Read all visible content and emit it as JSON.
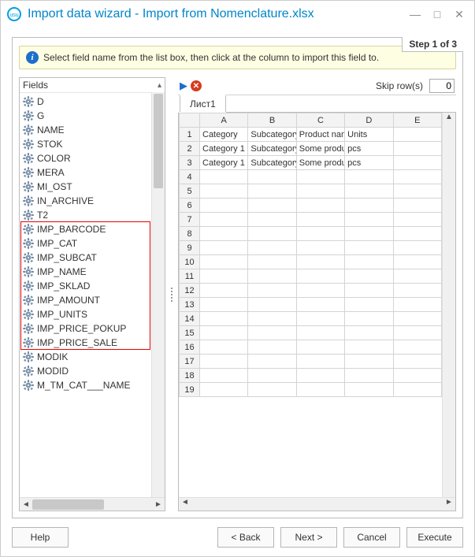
{
  "window": {
    "title": "Import data wizard - Import from Nomenclature.xlsx"
  },
  "step_label": "Step 1 of 3",
  "info_text": "Select field name from the list box, then click at the column to import this field to.",
  "fields_header": "Fields",
  "fields": [
    "D",
    "G",
    "NAME",
    "STOK",
    "COLOR",
    "MERA",
    "MI_OST",
    "IN_ARCHIVE",
    "T2",
    "IMP_BARCODE",
    "IMP_CAT",
    "IMP_SUBCAT",
    "IMP_NAME",
    "IMP_SKLAD",
    "IMP_AMOUNT",
    "IMP_UNITS",
    "IMP_PRICE_POKUP",
    "IMP_PRICE_SALE",
    "MODIK",
    "MODID",
    "M_TM_CAT___NAME"
  ],
  "highlight": {
    "start_index": 9,
    "end_index": 17
  },
  "skip_rows": {
    "label": "Skip row(s)",
    "value": "0"
  },
  "sheet_tab": "Лист1",
  "columns": [
    "A",
    "B",
    "C",
    "D",
    "E"
  ],
  "rows": [
    [
      "Category",
      "Subcategory",
      "Product name",
      "Units",
      ""
    ],
    [
      "Category 1",
      "Subcategory",
      "Some product",
      "pcs",
      ""
    ],
    [
      "Category 1",
      "Subcategory",
      "Some product",
      "pcs",
      ""
    ]
  ],
  "total_rows": 19,
  "buttons": {
    "help": "Help",
    "back": "< Back",
    "next": "Next >",
    "cancel": "Cancel",
    "execute": "Execute"
  }
}
